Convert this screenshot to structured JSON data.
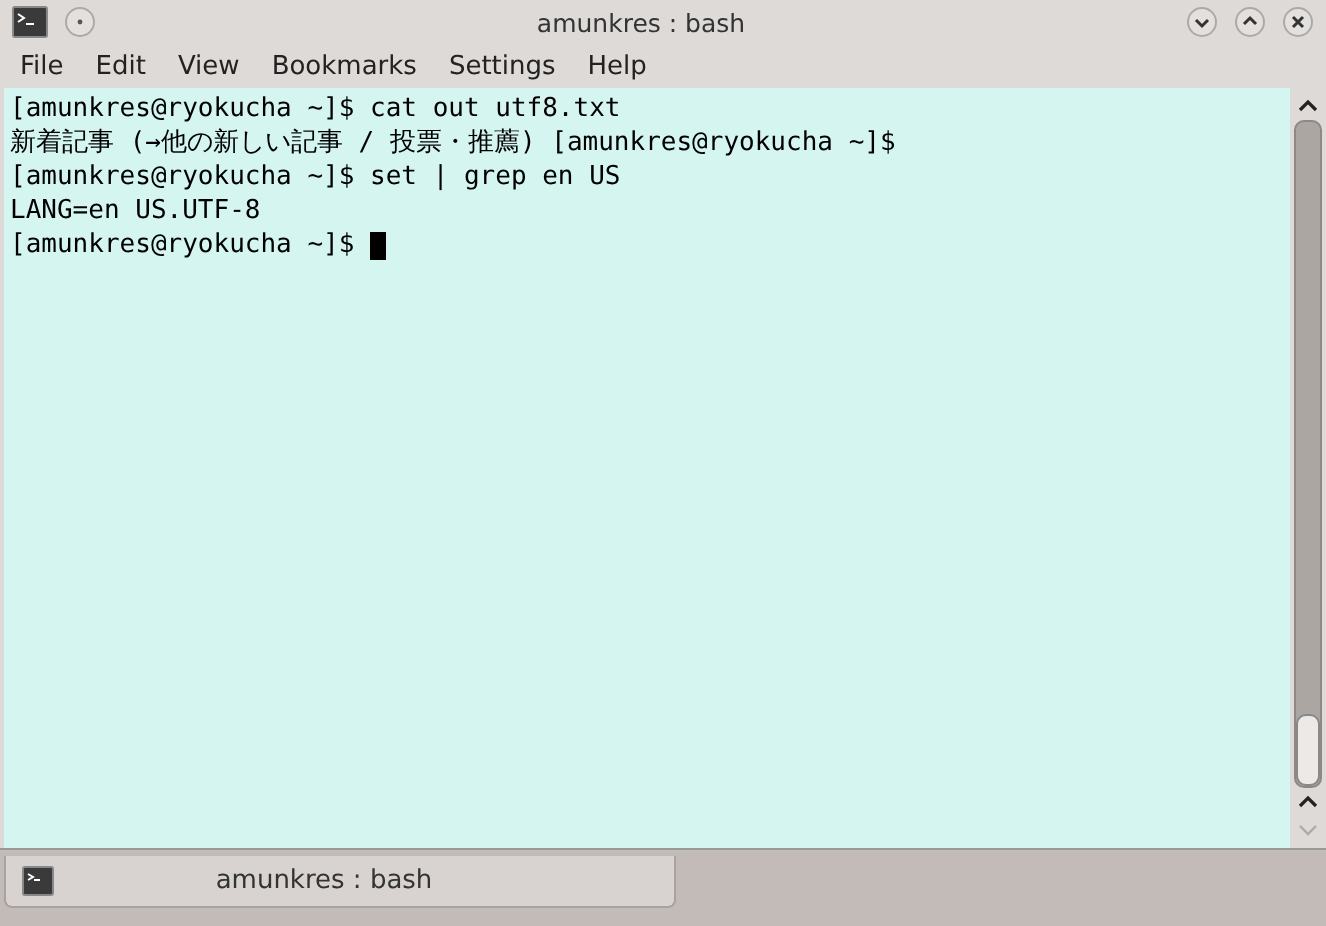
{
  "window": {
    "title": "amunkres : bash"
  },
  "menu": [
    "File",
    "Edit",
    "View",
    "Bookmarks",
    "Settings",
    "Help"
  ],
  "terminal": {
    "lines": [
      "[amunkres@ryokucha ~]$ cat out utf8.txt",
      "新着記事 (→他の新しい記事 / 投票・推薦) [amunkres@ryokucha ~]$",
      "[amunkres@ryokucha ~]$ set | grep en US",
      "LANG=en US.UTF-8",
      "[amunkres@ryokucha ~]$ "
    ],
    "cursor": true
  },
  "tabs": [
    {
      "label": "amunkres : bash",
      "selected": true
    }
  ]
}
